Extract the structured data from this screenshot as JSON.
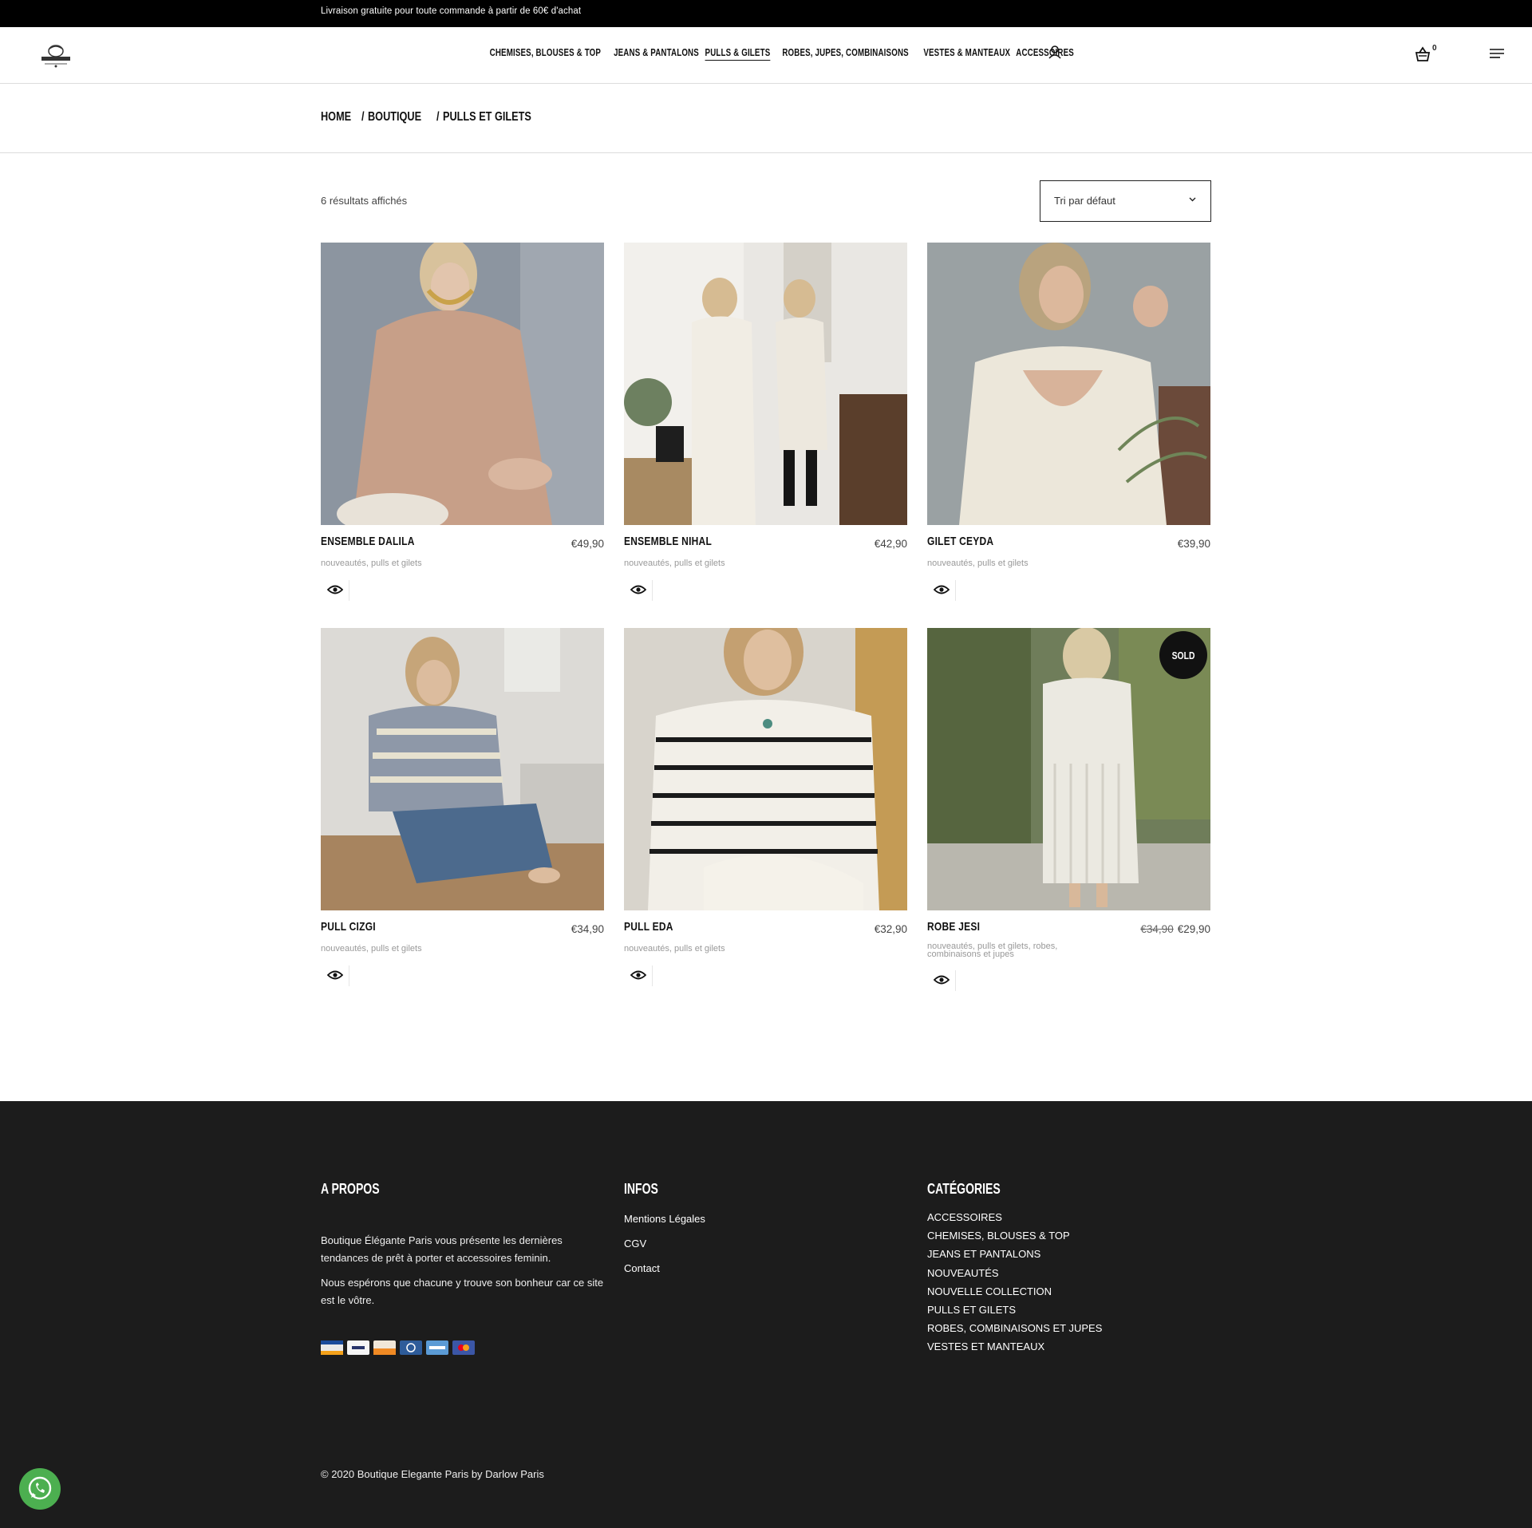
{
  "topbar": {
    "text": "Livraison gratuite pour toute commande à partir de 60€ d'achat"
  },
  "nav": {
    "items": [
      {
        "label": "CHEMISES, BLOUSES & TOP",
        "active": false
      },
      {
        "label": "JEANS & PANTALONS",
        "active": false
      },
      {
        "label": "PULLS & GILETS",
        "active": true
      },
      {
        "label": "ROBES, JUPES, COMBINAISONS",
        "active": false
      },
      {
        "label": "VESTES & MANTEAUX",
        "active": false
      },
      {
        "label": "ACCESSOIRES",
        "active": false
      }
    ],
    "cart_count": "0",
    "icons": {
      "user": "user-icon",
      "cart": "basket-icon",
      "menu": "hamburger-icon"
    }
  },
  "breadcrumb": {
    "home": "HOME",
    "shop": "BOUTIQUE",
    "current": "PULLS ET GILETS",
    "sep": "/"
  },
  "shop": {
    "results": "6 résultats affichés",
    "sort": "Tri par défaut"
  },
  "products": [
    {
      "name": "ENSEMBLE DALILA",
      "price": "€49,90",
      "old_price": "",
      "cats": [
        "nouveautés",
        "pulls et gilets"
      ],
      "sold": ""
    },
    {
      "name": "ENSEMBLE NIHAL",
      "price": "€42,90",
      "old_price": "",
      "cats": [
        "nouveautés",
        "pulls et gilets"
      ],
      "sold": ""
    },
    {
      "name": "GILET CEYDA",
      "price": "€39,90",
      "old_price": "",
      "cats": [
        "nouveautés",
        "pulls et gilets"
      ],
      "sold": ""
    },
    {
      "name": "PULL CIZGI",
      "price": "€34,90",
      "old_price": "",
      "cats": [
        "nouveautés",
        "pulls et gilets"
      ],
      "sold": ""
    },
    {
      "name": "PULL EDA",
      "price": "€32,90",
      "old_price": "",
      "cats": [
        "nouveautés",
        "pulls et gilets"
      ],
      "sold": ""
    },
    {
      "name": "ROBE JESI",
      "price": "€29,90",
      "old_price": "€34,90",
      "cats": [
        "nouveautés",
        "pulls et gilets",
        "robes, combinaisons et jupes"
      ],
      "sold": "SOLD"
    }
  ],
  "footer": {
    "about": {
      "title": "A PROPOS",
      "p1": "Boutique Élégante Paris vous présente les dernières tendances de prêt à porter et accessoires feminin.",
      "p2": "Nous espérons que chacune y trouve son bonheur car ce site est le vôtre."
    },
    "infos": {
      "title": "INFOS",
      "links": [
        "Mentions Légales",
        "CGV",
        "Contact"
      ]
    },
    "categories": {
      "title": "CATÉGORIES",
      "links": [
        "ACCESSOIRES",
        "CHEMISES, BLOUSES & TOP",
        "JEANS ET PANTALONS",
        "NOUVEAUTÉS",
        "NOUVELLE COLLECTION",
        "PULLS ET GILETS",
        "ROBES, COMBINAISONS ET JUPES",
        "VESTES ET MANTEAUX"
      ]
    },
    "payments": [
      "visa",
      "paypal",
      "discover",
      "diners",
      "american-express",
      "mastercard"
    ],
    "copyright": "© 2020 Boutique Elegante Paris by Darlow Paris"
  },
  "colors": {
    "topbar": "#000000",
    "footer": "#1c1c1c",
    "whatsapp": "#4caf50"
  }
}
